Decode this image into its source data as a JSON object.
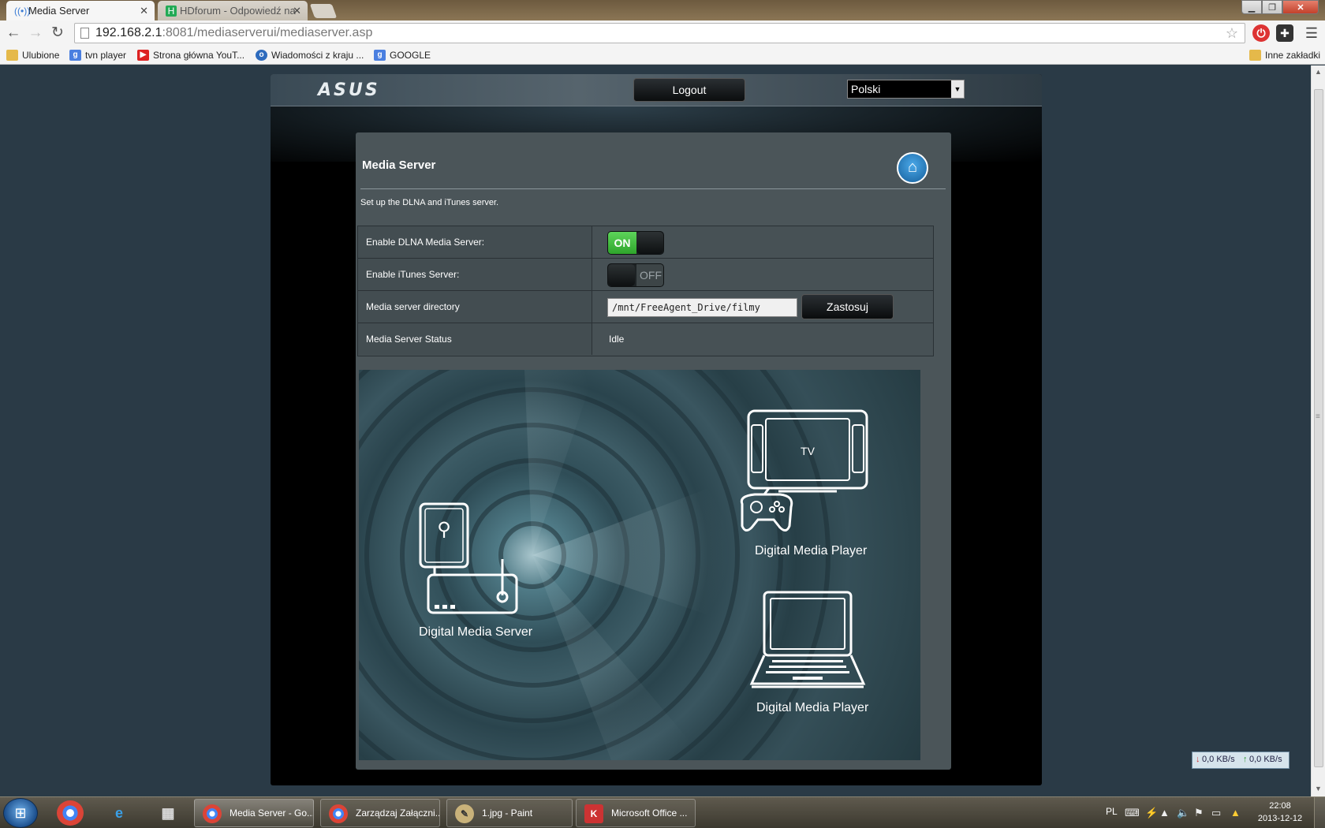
{
  "browser": {
    "tabs": [
      {
        "title": "Media Server",
        "active": true
      },
      {
        "title": "HDforum - Odpowiedź na",
        "active": false
      }
    ],
    "url_host": "192.168.2.1",
    "url_path": ":8081/mediaserverui/mediaserver.asp",
    "bookmarks": [
      {
        "label": "Ulubione",
        "icon": "folder-icon"
      },
      {
        "label": "tvn player",
        "icon": "google-icon"
      },
      {
        "label": "Strona główna YouT...",
        "icon": "youtube-icon"
      },
      {
        "label": "Wiadomości z kraju ...",
        "icon": "onet-icon"
      },
      {
        "label": "GOOGLE",
        "icon": "google-icon"
      }
    ],
    "other_bookmarks": "Inne zakładki"
  },
  "router": {
    "logo": "ASUS",
    "logout_label": "Logout",
    "language": "Polski"
  },
  "panel": {
    "title": "Media Server",
    "description": "Set up the DLNA and iTunes server.",
    "rows": [
      {
        "label": "Enable DLNA Media Server:",
        "toggle_text": "ON",
        "state": "on"
      },
      {
        "label": "Enable iTunes Server:",
        "toggle_text": "OFF",
        "state": "off"
      },
      {
        "label": "Media server directory",
        "value": "/mnt/FreeAgent_Drive/filmy",
        "button": "Zastosuj"
      },
      {
        "label": "Media Server Status",
        "value": "Idle"
      }
    ]
  },
  "diagram": {
    "server_label": "Digital  Media Server",
    "tv_text": "TV",
    "player_label_1": "Digital  Media Player",
    "player_label_2": "Digital  Media Player"
  },
  "netmeter": {
    "down": "0,0 KB/s",
    "up": "0,0 KB/s"
  },
  "taskbar": {
    "tasks": [
      {
        "label": "Media Server - Go...",
        "icon": "chrome-icon"
      },
      {
        "label": "Zarządzaj Załączni...",
        "icon": "chrome-icon"
      },
      {
        "label": "1.jpg - Paint",
        "icon": "paint-icon"
      },
      {
        "label": "Microsoft Office ...",
        "icon": "office-icon"
      }
    ],
    "language": "PL",
    "time": "22:08",
    "date": "2013-12-12"
  },
  "colors": {
    "toggle_on": "#3fbf3c",
    "panel_bg": "#4b5559",
    "page_bg": "#2a3a46"
  }
}
